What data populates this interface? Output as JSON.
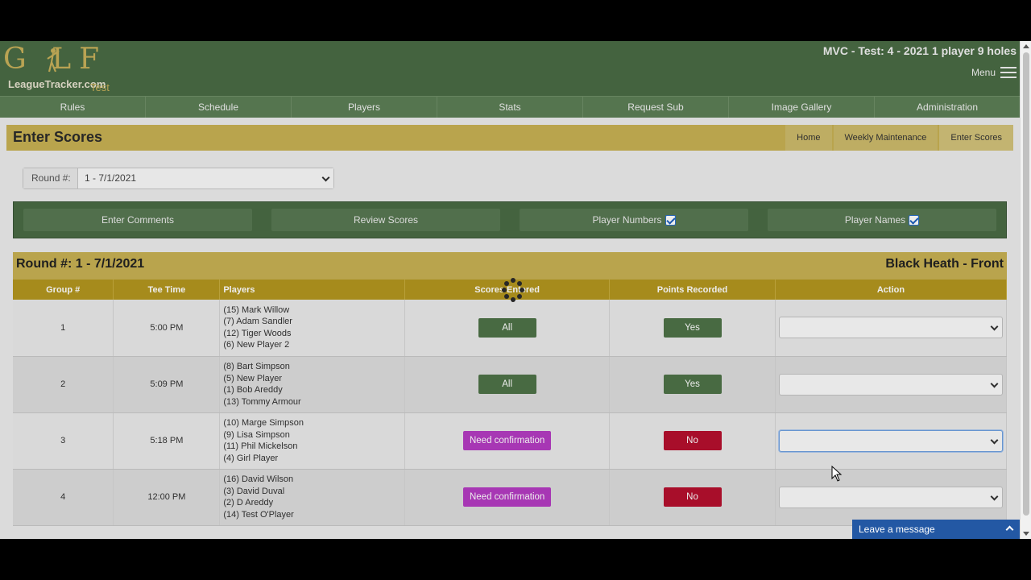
{
  "header": {
    "logo_word": "G LF",
    "logo_site": "LeagueTracker.com",
    "logo_tag": "Test",
    "league_title": "MVC - Test: 4 - 2021 1 player 9 holes",
    "menu_label": "Menu"
  },
  "nav": {
    "items": [
      "Rules",
      "Schedule",
      "Players",
      "Stats",
      "Request Sub",
      "Image Gallery",
      "Administration"
    ]
  },
  "page": {
    "title": "Enter Scores",
    "breadcrumb": [
      "Home",
      "Weekly Maintenance",
      "Enter Scores"
    ]
  },
  "round_select": {
    "label": "Round #:",
    "value": "1 - 7/1/2021"
  },
  "toolbar": {
    "enter_comments": "Enter Comments",
    "review_scores": "Review Scores",
    "player_numbers": "Player Numbers",
    "player_names": "Player Names"
  },
  "round_header": {
    "round": "Round #: 1 - 7/1/2021",
    "course": "Black Heath - Front"
  },
  "table": {
    "columns": [
      "Group #",
      "Tee Time",
      "Players",
      "Scores Entered",
      "Points Recorded",
      "Action"
    ],
    "rows": [
      {
        "group": "1",
        "tee": "5:00 PM",
        "players": [
          "(15) Mark Willow",
          "(7) Adam Sandler",
          "(12) Tiger Woods",
          "(6) New Player 2"
        ],
        "scores": "All",
        "points": "Yes"
      },
      {
        "group": "2",
        "tee": "5:09 PM",
        "players": [
          "(8) Bart Simpson",
          "(5) New Player",
          "(1) Bob Areddy",
          "(13) Tommy Armour"
        ],
        "scores": "All",
        "points": "Yes"
      },
      {
        "group": "3",
        "tee": "5:18 PM",
        "players": [
          "(10) Marge Simpson",
          "(9) Lisa Simpson",
          "(11) Phil Mickelson",
          "(4) Girl Player"
        ],
        "scores": "Need confirmation",
        "points": "No"
      },
      {
        "group": "4",
        "tee": "12:00 PM",
        "players": [
          "(16) David Wilson",
          "(3) David Duval",
          "(2) D Areddy",
          "(14) Test O'Player"
        ],
        "scores": "Need confirmation",
        "points": "No"
      }
    ]
  },
  "chat": {
    "label": "Leave a message"
  },
  "colors": {
    "header_green": "#4a6b44",
    "gold": "#c7b153",
    "table_header": "#b3961f",
    "ok_green": "#4e7347",
    "no_red": "#b5102e",
    "need_purple": "#b43cc2",
    "chat_blue": "#2358a4"
  }
}
